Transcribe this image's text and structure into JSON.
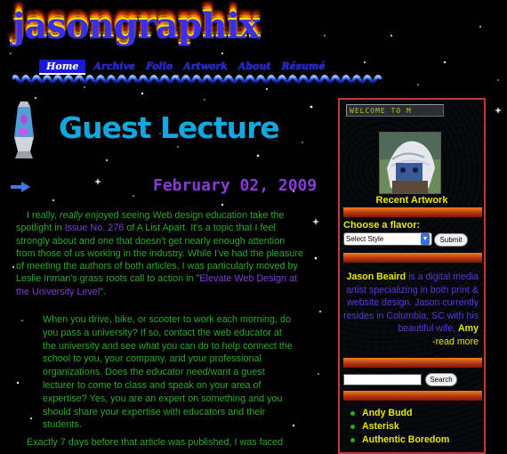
{
  "site": {
    "logo": "jasongraphix"
  },
  "nav": {
    "items": [
      "Home",
      "Archive",
      "Folio",
      "Artwork",
      "About",
      "Résumé"
    ],
    "active": "Home"
  },
  "post": {
    "title": "Guest Lecture",
    "date": "February 02, 2009",
    "p1_a": "I really, ",
    "p1_em": "really",
    "p1_b": " enjoyed seeing Web design education take the spotlight in ",
    "p1_link1": "Issue No. 276",
    "p1_c": " of A List Apart. It's a topic that I feel strongly about and one that doesn't get nearly enough attention from those of us working in the industry. While I've had the pleasure of meeting the authors of both articles, I was particularly moved by Leslie Inman's grass roots call to action in \"",
    "p1_link2": "Elevate Web Design at the University Level",
    "p1_d": "\".",
    "quote": "When you drive, bike, or scooter to work each morning, do you pass a university? If so, contact the web educator at the university and see what you can do to help connect the school to you, your company, and your professional organizations. Does the educator need/want a guest lecturer to come to class and speak on your area of expertise? Yes, you are an expert on something and you should share your expertise with educators and their students.",
    "next_cut": "Exactly 7 days before that article was published, I was faced"
  },
  "sidebar": {
    "welcome": "WELCOME TO M",
    "artwork_caption": "Recent Artwork",
    "flavor_label": "Choose a flavor:",
    "style_select": "Select Style",
    "submit_label": "Submit",
    "bio_name": "Jason Beaird",
    "bio_text": " is a digital media artist specializing in both print & website design. Jason currently resides in Columbia, SC with his beautiful wife, ",
    "bio_wife": "Amy",
    "bio_more": "-read more",
    "search_label": "Search",
    "links": [
      "Andy Budd",
      "Asterisk",
      "Authentic Boredom"
    ]
  },
  "colors": {
    "accent": "#e8e800",
    "link": "#7b3fd8",
    "body_text": "#2aa82a",
    "heading": "#10a8e0",
    "border": "#c03838"
  }
}
